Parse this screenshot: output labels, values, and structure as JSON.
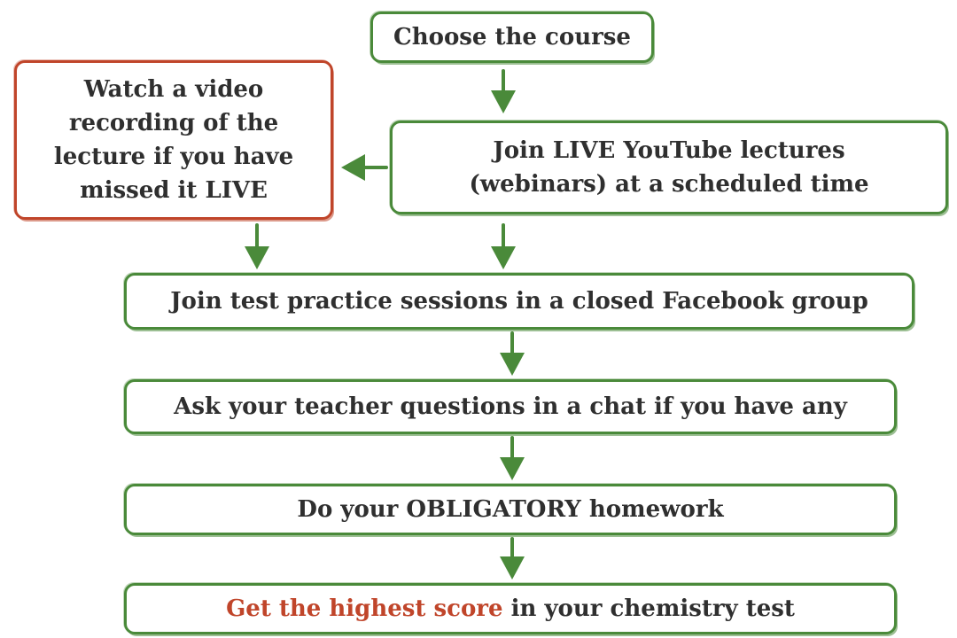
{
  "steps": {
    "choose_course": "Choose the course",
    "watch_video": {
      "line1": "Watch a video",
      "line2": "recording of the",
      "line3": "lecture if you have",
      "line4": "missed it LIVE"
    },
    "join_live": {
      "line1": "Join LIVE YouTube lectures",
      "line2": "(webinars) at a scheduled time"
    },
    "test_practice": "Join test practice sessions in a closed Facebook group",
    "ask_teacher": "Ask your teacher questions in a chat if you have any",
    "homework": "Do your OBLIGATORY homework",
    "final": {
      "highlight": "Get the highest score",
      "rest": " in your chemistry test"
    }
  },
  "colors": {
    "green_border": "#4a8a3a",
    "red_border": "#c0452a",
    "arrow_green": "#4a8a3a",
    "text": "#2f2f2f",
    "highlight_text": "#c0452a"
  },
  "icons": {
    "arrow": "arrow-down-icon",
    "arrow_left": "arrow-left-icon"
  }
}
